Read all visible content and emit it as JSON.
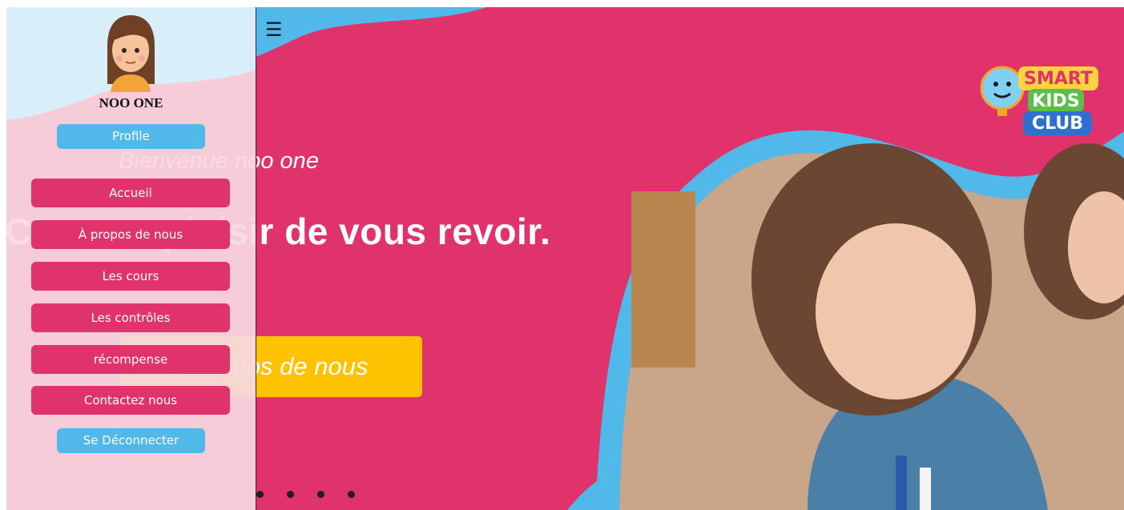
{
  "sidebar": {
    "username": "NOO ONE",
    "profile_label": "Profile",
    "logout_label": "Se Déconnecter",
    "items": [
      {
        "label": "Accueil"
      },
      {
        "label": "À propos de nous"
      },
      {
        "label": "Les cours"
      },
      {
        "label": "Les contrôles"
      },
      {
        "label": "récompense"
      },
      {
        "label": "Contactez nous"
      }
    ]
  },
  "hero": {
    "welcome": "Bienvenue noo one",
    "headline": "C'est un plaisir de vous revoir.",
    "cta_label": "À propos de nous",
    "slides_count": 4
  },
  "logo": {
    "text_lines": [
      "SMART",
      "KIDS",
      "CLUB"
    ]
  },
  "menu_icon": "hamburger-icon",
  "colors": {
    "primary_pink": "#e0336c",
    "accent_blue": "#51b9e9",
    "cta_yellow": "#ffc200",
    "sidebar_bg": "#f7d8e1",
    "sidebar_top_bg": "#d8eef9"
  }
}
